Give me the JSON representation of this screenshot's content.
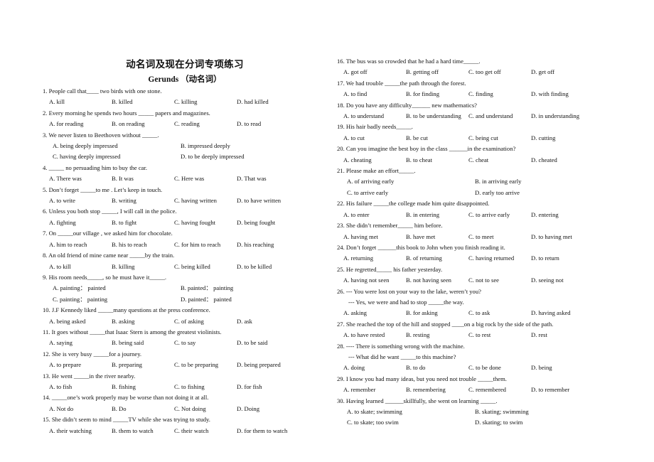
{
  "document": {
    "title": "动名词及现在分词专项练习",
    "subtitle": "Gerunds  （动名词）"
  },
  "left_column": [
    {
      "number": "1.",
      "stem": "People call that____ two birds with one stone.",
      "option_rows": [
        [
          "A. kill",
          "B. killed",
          "C. killing",
          "D. had killed"
        ]
      ]
    },
    {
      "number": "2.",
      "stem": "Every morning he spends two hours _____ papers and magazines.",
      "option_rows": [
        [
          "A. for reading",
          "B. on reading",
          "C. reading",
          "D. to read"
        ]
      ]
    },
    {
      "number": "3.",
      "stem": "We never listen to Beethoven without _____.",
      "option_rows": [
        [
          "A. being deeply impressed",
          "B. impressed deeply"
        ],
        [
          "C. having deeply impressed",
          "D. to be deeply impressed"
        ]
      ]
    },
    {
      "number": "4.",
      "stem": "_____ no persuading him to buy the car.",
      "option_rows": [
        [
          "A. There was",
          "B. It was",
          "C. Here was",
          "D. That was"
        ]
      ]
    },
    {
      "number": "5.",
      "stem": "Don’t forget _____to me . Let’s keep in touch.",
      "option_rows": [
        [
          "A. to write",
          "B. writing",
          "C. having written",
          "D. to have written"
        ]
      ]
    },
    {
      "number": "6.",
      "stem": "Unless you both stop _____, I will call in the police.",
      "option_rows": [
        [
          "A. fighting",
          "B. to fight",
          "C. having fought",
          "D. being fought"
        ]
      ]
    },
    {
      "number": "7.",
      "stem": "On _____our village , we asked him for chocolate.",
      "option_rows": [
        [
          "A. him to reach",
          "B. his to reach",
          "C. for him to reach",
          "D. his reaching"
        ]
      ]
    },
    {
      "number": "8.",
      "stem": "An old friend of mine came near _____by the train.",
      "option_rows": [
        [
          "A. to kill",
          "B. killing",
          "C. being killed",
          "D. to be killed"
        ]
      ]
    },
    {
      "number": "9.",
      "stem": "His room needs_____, so he must have it_____.",
      "option_rows": [
        [
          "A. painting：  painted",
          "B. painted：  painting"
        ],
        [
          "C. painting：  painting",
          "D. painted：  painted"
        ]
      ]
    },
    {
      "number": "10.",
      "stem": "J.F Kennedy liked _____many questions at the press conference.",
      "option_rows": [
        [
          "A. being asked",
          "B. asking",
          "C. of asking",
          "D. ask"
        ]
      ]
    },
    {
      "number": "11.",
      "stem": "It goes without _____that Isaac Stern is among the greatest violinists.",
      "option_rows": [
        [
          "A. saying",
          "B. being said",
          "C. to say",
          "D. to be said"
        ]
      ]
    },
    {
      "number": "12.",
      "stem": "She is very busy _____for a journey.",
      "option_rows": [
        [
          "A. to prepare",
          "B. preparing",
          "C. to be preparing",
          "D. being prepared"
        ]
      ]
    },
    {
      "number": "13.",
      "stem": "He went _____in the river nearby.",
      "option_rows": [
        [
          "A. to fish",
          "B. fishing",
          "C. to fishing",
          "D. for fish"
        ]
      ]
    },
    {
      "number": "14.",
      "stem": "_____one’s work properly may be worse than not doing it at all.",
      "option_rows": [
        [
          "A. Not do",
          "B. Do",
          "C. Not doing",
          "D. Doing"
        ]
      ]
    },
    {
      "number": "15.",
      "stem": "She didn’t seem to mind _____TV while she was trying to study.",
      "option_rows": [
        [
          "A. their watching",
          "B. them to watch",
          "C. their watch",
          "D. for them to watch"
        ]
      ]
    }
  ],
  "right_column": [
    {
      "number": "16.",
      "stem": "The bus was so crowded that he had a hard time_____.",
      "option_rows": [
        [
          "A. got off",
          "B. getting off",
          "C. too get off",
          "D. get off"
        ]
      ]
    },
    {
      "number": "17.",
      "stem": "We had trouble _____the path through the forest.",
      "option_rows": [
        [
          "A. to find",
          "B. for finding",
          "C. finding",
          "D. with finding"
        ]
      ]
    },
    {
      "number": "18.",
      "stem": "Do you have any difficulty______ new mathematics?",
      "option_rows": [
        [
          "A. to understand",
          "B. to be understanding",
          "C. and understand",
          "D. in understanding"
        ]
      ]
    },
    {
      "number": "19.",
      "stem": "His hair badly needs_____.",
      "option_rows": [
        [
          "A. to cut",
          "B. be cut",
          "C. being cut",
          "D. cutting"
        ]
      ]
    },
    {
      "number": "20.",
      "stem": "Can you imagine the best boy in the class ______in the examination?",
      "option_rows": [
        [
          "A. cheating",
          "B. to cheat",
          "C. cheat",
          "D. cheated"
        ]
      ]
    },
    {
      "number": "21.",
      "stem": "Please make an effort_____.",
      "option_rows": [
        [
          "A. of arriving early",
          "B. in arriving early"
        ],
        [
          "C. to arrive early",
          "D. early too arrive"
        ]
      ]
    },
    {
      "number": "22.",
      "stem": "His failure _____the college made him quite disappointed.",
      "option_rows": [
        [
          "A. to enter",
          "B. in entering",
          "C. to arrive early",
          "D. entering"
        ]
      ]
    },
    {
      "number": "23.",
      "stem": "She didn’t remember_____ him before.",
      "option_rows": [
        [
          "A. having met",
          "B. have met",
          "C. to meet",
          "D. to having met"
        ]
      ]
    },
    {
      "number": "24.",
      "stem": "Don’t forget ______this book to John when you finish reading it.",
      "option_rows": [
        [
          "A. returning",
          "B. of returning",
          "C. having returned",
          "D. to return"
        ]
      ]
    },
    {
      "number": "25.",
      "stem": "He regretted_____ his father yesterday.",
      "option_rows": [
        [
          "A. having not seen",
          "B. not having seen",
          "C. not to see",
          "D. seeing not"
        ]
      ]
    },
    {
      "number": "26.",
      "stem": "--- You were lost on your way to the lake, weren’t you?",
      "sub_stem": "--- Yes, we were and had to stop _____the way.",
      "option_rows": [
        [
          "A. asking",
          "B. for asking",
          "C. to ask",
          "D. having asked"
        ]
      ]
    },
    {
      "number": "27.",
      "stem": "She reached the top of the hill and stopped ____on a big rock by the side of the path.",
      "option_rows": [
        [
          "A. to have rested",
          "B. resting",
          "C. to rest",
          "D. rest"
        ]
      ]
    },
    {
      "number": "28.",
      "stem": "---- There is something wrong with the machine.",
      "sub_stem": "--- What did he want _____to this machine?",
      "option_rows": [
        [
          "A. doing",
          "B. to do",
          "C. to be done",
          "D. being"
        ]
      ]
    },
    {
      "number": "29.",
      "stem": "I know you had many ideas, but you need not trouble _____them.",
      "option_rows": [
        [
          "A. remember",
          "B. remembering",
          "C. remembered",
          "D. to remember"
        ]
      ]
    },
    {
      "number": "30.",
      "stem": "Having learned ______skillfully, she went on learning _____.",
      "option_rows": [
        [
          "A. to skate; swimming",
          "B. skating; swimming"
        ],
        [
          "C. to skate; too swim",
          "D. skating; to swim"
        ]
      ]
    }
  ]
}
